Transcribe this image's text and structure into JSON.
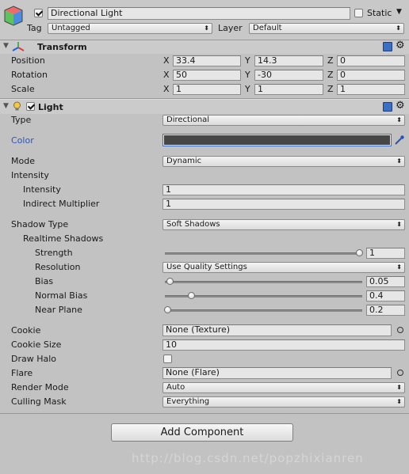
{
  "header": {
    "active_checked": true,
    "object_name": "Directional Light",
    "static_label": "Static",
    "static_checked": false,
    "tag_label": "Tag",
    "tag_value": "Untagged",
    "layer_label": "Layer",
    "layer_value": "Default"
  },
  "transform": {
    "title": "Transform",
    "rows": [
      {
        "label": "Position",
        "x": "33.4",
        "y": "14.3",
        "z": "0"
      },
      {
        "label": "Rotation",
        "x": "50",
        "y": "-30",
        "z": "0"
      },
      {
        "label": "Scale",
        "x": "1",
        "y": "1",
        "z": "1"
      }
    ],
    "axis_x": "X",
    "axis_y": "Y",
    "axis_z": "Z"
  },
  "light": {
    "title": "Light",
    "enabled": true,
    "type_label": "Type",
    "type_value": "Directional",
    "color_label": "Color",
    "color_value": "#464646",
    "mode_label": "Mode",
    "mode_value": "Dynamic",
    "intensity_header": "Intensity",
    "intensity_label": "Intensity",
    "intensity_value": "1",
    "indirect_label": "Indirect Multiplier",
    "indirect_value": "1",
    "shadow_type_label": "Shadow Type",
    "shadow_type_value": "Soft Shadows",
    "realtime_label": "Realtime Shadows",
    "strength_label": "Strength",
    "strength_value": "1",
    "resolution_label": "Resolution",
    "resolution_value": "Use Quality Settings",
    "bias_label": "Bias",
    "bias_value": "0.05",
    "normal_bias_label": "Normal Bias",
    "normal_bias_value": "0.4",
    "near_plane_label": "Near Plane",
    "near_plane_value": "0.2",
    "cookie_label": "Cookie",
    "cookie_value": "None (Texture)",
    "cookie_size_label": "Cookie Size",
    "cookie_size_value": "10",
    "draw_halo_label": "Draw Halo",
    "draw_halo_checked": false,
    "flare_label": "Flare",
    "flare_value": "None (Flare)",
    "render_mode_label": "Render Mode",
    "render_mode_value": "Auto",
    "culling_label": "Culling Mask",
    "culling_value": "Everything"
  },
  "add_component_label": "Add Component",
  "watermark": "http://blog.csdn.net/popzhixianren",
  "icons": {
    "object": "cube-icon",
    "transform": "transform-axes-icon",
    "light": "light-bulb-icon",
    "help": "help-book-icon",
    "settings": "gear-icon",
    "eyedropper": "eyedropper-icon",
    "object_picker": "object-picker-icon"
  }
}
